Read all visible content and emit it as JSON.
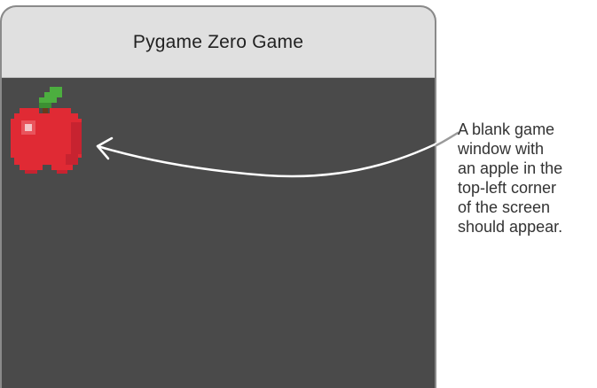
{
  "window": {
    "title": "Pygame Zero Game"
  },
  "game": {
    "sprite_name": "apple-icon",
    "colors": {
      "background": "#4a4a4a",
      "apple_red": "#e02a34",
      "apple_dark": "#b81e2a",
      "leaf_green": "#4cae3f",
      "highlight": "#f4a9ad"
    }
  },
  "annotation": {
    "lines": [
      "A blank game",
      "window with",
      "an apple in the",
      "top-left corner",
      "of the screen",
      "should appear."
    ]
  }
}
